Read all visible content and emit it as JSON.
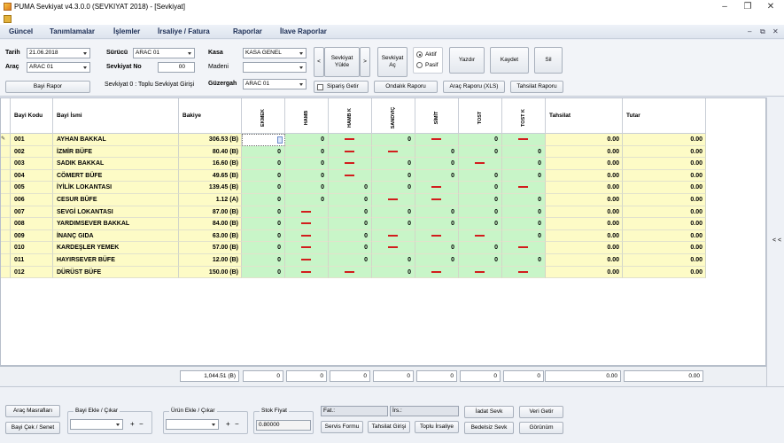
{
  "window": {
    "title": "PUMA Sevkiyat v4.3.0.0 (SEVKIYAT 2018) - [Sevkiyat]",
    "min": "–",
    "max": "❐",
    "close": "✕"
  },
  "menu": [
    "Güncel",
    "Tanımlamalar",
    "İşlemler",
    "İrsaliye / Fatura",
    "Raporlar",
    "İlave Raporlar"
  ],
  "mdi": {
    "min": "–",
    "restore": "⧉",
    "close": "✕"
  },
  "form": {
    "tarih_label": "Tarih",
    "tarih": "21.06.2018",
    "arac_label": "Araç",
    "arac": "ARAC 01",
    "surucu_label": "Sürücü",
    "surucu": "ARAC 01",
    "sevkiyat_no_label": "Sevkiyat No",
    "sevkiyat_no": "00",
    "kasa_label": "Kasa",
    "kasa": "KASA GENEL",
    "madeni_label": "Madeni",
    "madeni": "",
    "guzergah_label": "Güzergah",
    "guzergah": "ARAC 01",
    "info": "Sevkiyat 0 : Toplu Sevkiyat Girişi"
  },
  "buttons": {
    "prev": "<",
    "sevkiyat_yukle": "Sevkiyat Yükle",
    "next": ">",
    "sevkiyat_ac": "Sevkiyat Aç",
    "aktif": "Aktif",
    "pasif": "Pasif",
    "yazdir": "Yazdır",
    "kaydet": "Kaydet",
    "sil": "Sil",
    "bayi_rapor": "Bayi Rapor",
    "siparis_getir": "Sipariş Getir",
    "ondalik": "Ondalık Raporu",
    "arac_raporu": "Araç Raporu (XLS)",
    "tahsilat_raporu": "Tahsilat Raporu"
  },
  "grid": {
    "headers": {
      "kod": "Bayi Kodu",
      "isim": "Bayi İsmi",
      "bakiye": "Bakiye",
      "tahsilat": "Tahsilat",
      "tutar": "Tutar"
    },
    "products": [
      "EKMEK",
      "HAMB",
      "HAMB K",
      "SANDVIÇ",
      "SİMİT",
      "TOST",
      "TOST K"
    ],
    "rows": [
      {
        "kod": "001",
        "isim": "AYHAN BAKKAL",
        "bakiye": "306.53 (B)",
        "p": [
          "",
          "0",
          "—",
          "0",
          "—",
          "0",
          "—"
        ],
        "tahsilat": "0.00",
        "tutar": "0.00"
      },
      {
        "kod": "002",
        "isim": "İZMİR BÜFE",
        "bakiye": "80.40 (B)",
        "p": [
          "0",
          "0",
          "—",
          "—",
          "0",
          "0",
          "0"
        ],
        "tahsilat": "0.00",
        "tutar": "0.00"
      },
      {
        "kod": "003",
        "isim": "SADIK BAKKAL",
        "bakiye": "16.60 (B)",
        "p": [
          "0",
          "0",
          "—",
          "0",
          "0",
          "—",
          "0"
        ],
        "tahsilat": "0.00",
        "tutar": "0.00"
      },
      {
        "kod": "004",
        "isim": "CÖMERT BÜFE",
        "bakiye": "49.65 (B)",
        "p": [
          "0",
          "0",
          "—",
          "0",
          "0",
          "0",
          "0"
        ],
        "tahsilat": "0.00",
        "tutar": "0.00"
      },
      {
        "kod": "005",
        "isim": "İYİLİK LOKANTASI",
        "bakiye": "139.45 (B)",
        "p": [
          "0",
          "0",
          "0",
          "0",
          "—",
          "0",
          "—"
        ],
        "tahsilat": "0.00",
        "tutar": "0.00"
      },
      {
        "kod": "006",
        "isim": "CESUR BÜFE",
        "bakiye": "1.12 (A)",
        "p": [
          "0",
          "0",
          "0",
          "—",
          "—",
          "0",
          "0"
        ],
        "tahsilat": "0.00",
        "tutar": "0.00"
      },
      {
        "kod": "007",
        "isim": "SEVGİ LOKANTASI",
        "bakiye": "87.00 (B)",
        "p": [
          "0",
          "—",
          "0",
          "0",
          "0",
          "0",
          "0"
        ],
        "tahsilat": "0.00",
        "tutar": "0.00"
      },
      {
        "kod": "008",
        "isim": "YARDIMSEVER BAKKAL",
        "bakiye": "84.00 (B)",
        "p": [
          "0",
          "—",
          "0",
          "0",
          "0",
          "0",
          "0"
        ],
        "tahsilat": "0.00",
        "tutar": "0.00"
      },
      {
        "kod": "009",
        "isim": "İNANÇ GIDA",
        "bakiye": "63.00 (B)",
        "p": [
          "0",
          "—",
          "0",
          "—",
          "—",
          "—",
          "0"
        ],
        "tahsilat": "0.00",
        "tutar": "0.00"
      },
      {
        "kod": "010",
        "isim": "KARDEŞLER YEMEK",
        "bakiye": "57.00 (B)",
        "p": [
          "0",
          "—",
          "0",
          "—",
          "0",
          "0",
          "—"
        ],
        "tahsilat": "0.00",
        "tutar": "0.00"
      },
      {
        "kod": "011",
        "isim": "HAYIRSEVER BÜFE",
        "bakiye": "12.00 (B)",
        "p": [
          "0",
          "—",
          "0",
          "0",
          "0",
          "0",
          "0"
        ],
        "tahsilat": "0.00",
        "tutar": "0.00"
      },
      {
        "kod": "012",
        "isim": "DÜRÜST BÜFE",
        "bakiye": "150.00 (B)",
        "p": [
          "0",
          "—",
          "—",
          "0",
          "—",
          "—",
          "—"
        ],
        "tahsilat": "0.00",
        "tutar": "0.00"
      }
    ],
    "totals": {
      "bakiye": "1,044.51 (B)",
      "p": [
        "0",
        "0",
        "0",
        "0",
        "0",
        "0",
        "0"
      ],
      "tahsilat": "0.00",
      "tutar": "0.00"
    }
  },
  "side": {
    "collapse": "< <"
  },
  "bottom": {
    "arac_masraflari": "Araç Masrafları",
    "bayi_cek_senet": "Bayi Çek / Senet",
    "bayi_ekle_cikar": "Bayi Ekle / Çıkar",
    "urun_ekle_cikar": "Ürün Ekle / Çıkar",
    "stok_fiyat": "Stok Fiyat",
    "stok_fiyat_value": "0.80000",
    "fat": "Fat.:",
    "irs": "İrs.:",
    "servis_formu": "Servis Formu",
    "tahsilat_girisi": "Tahsilat Girişi",
    "toplu_irsaliye": "Toplu İrsaliye",
    "iade_sevk": "İadat Sevk",
    "bedelsiz_sevk": "Bedelsiz Sevk",
    "veri_getir": "Veri Getir",
    "gorunum": "Görünüm"
  }
}
